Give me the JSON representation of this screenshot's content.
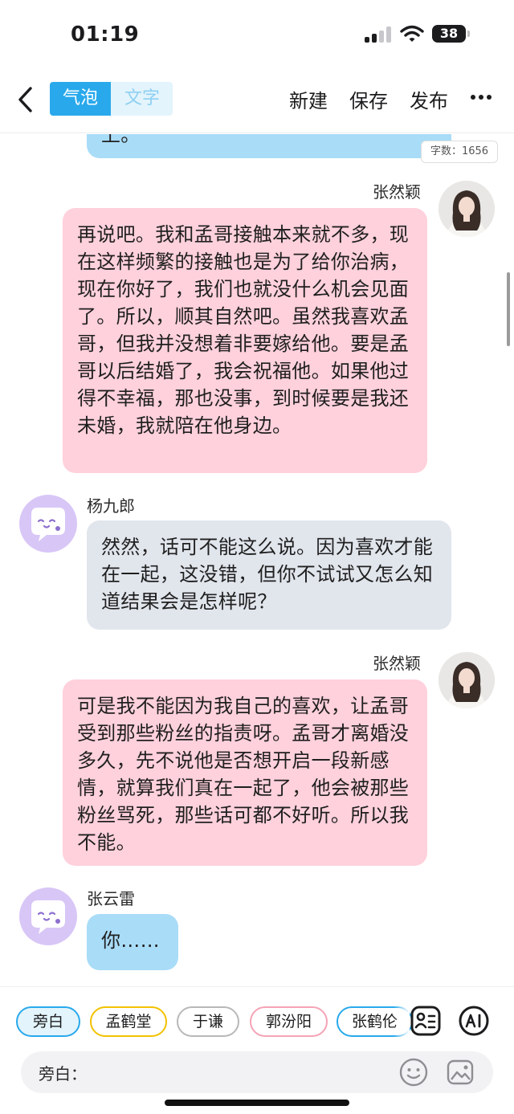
{
  "status": {
    "time": "01:19",
    "battery": "38"
  },
  "nav": {
    "tabs": [
      "气泡",
      "文字"
    ],
    "actions": {
      "new": "新建",
      "save": "保存",
      "publish": "发布"
    }
  },
  "word_count": "字数：1656",
  "messages": [
    {
      "speaker": "",
      "text": "上。"
    },
    {
      "speaker": "张然颖",
      "text": "再说吧。我和孟哥接触本来就不多，现在这样频繁的接触也是为了给你治病，现在你好了，我们也就没什么机会见面了。所以，顺其自然吧。虽然我喜欢孟哥，但我并没想着非要嫁给他。要是孟哥以后结婚了，我会祝福他。如果他过得不幸福，那也没事，到时候要是我还未婚，我就陪在他身边。"
    },
    {
      "speaker": "杨九郎",
      "text": "然然，话可不能这么说。因为喜欢才能在一起，这没错，但你不试试又怎么知道结果会是怎样呢？"
    },
    {
      "speaker": "张然颖",
      "text": "可是我不能因为我自己的喜欢，让孟哥受到那些粉丝的指责呀。孟哥才离婚没多久，先不说他是否想开启一段新感情，就算我们真在一起了，他会被那些粉丝骂死，那些话可都不好听。所以我不能。"
    },
    {
      "speaker": "张云雷",
      "text": "你……"
    }
  ],
  "characters": [
    "旁白",
    "孟鹤堂",
    "于谦",
    "郭汾阳",
    "张鹤伦"
  ],
  "input": {
    "label": "旁白：",
    "value": ""
  },
  "icons": {
    "back": "chevron-left-icon",
    "more": "more-horizontal-icon",
    "roles": "role-list-icon",
    "ai": "ai-icon",
    "emoji": "emoji-icon",
    "image": "image-icon"
  },
  "colors": {
    "accent": "#29a9ec",
    "bubble_blue": "#a9dcf7",
    "bubble_pink": "#ffd1dc",
    "bubble_grey": "#e1e5ec",
    "bot_avatar": "#d8c6f7"
  }
}
